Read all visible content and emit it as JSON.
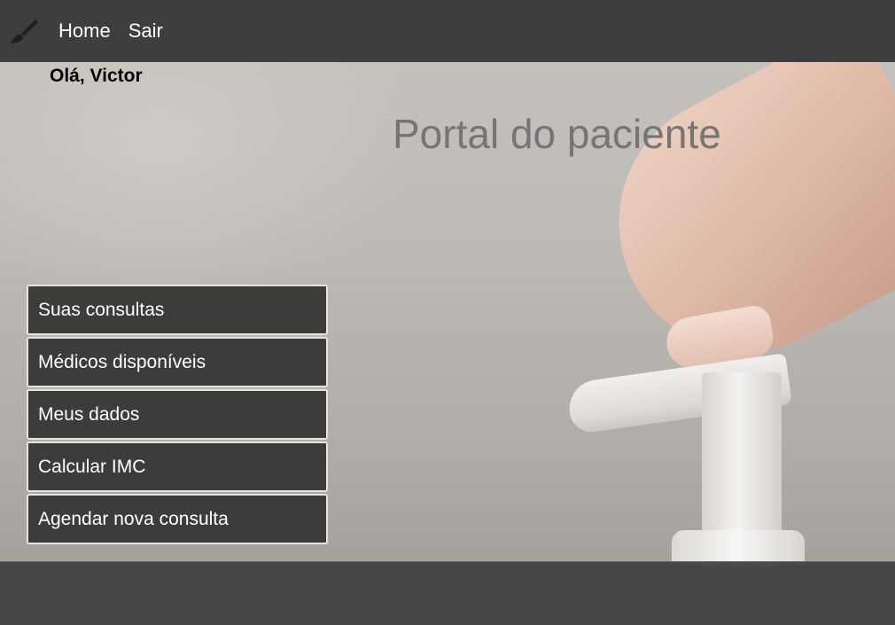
{
  "nav": {
    "brand_icon": "paintbrush-icon",
    "links": [
      "Home",
      "Sair"
    ]
  },
  "greeting": "Olá, Victor",
  "title": "Portal do paciente",
  "menu": {
    "items": [
      "Suas consultas",
      "Médicos disponíveis",
      "Meus dados",
      "Calcular IMC",
      "Agendar nova consulta"
    ]
  },
  "colors": {
    "navbar": "#3d3e40",
    "menu_button": "#3d3c3b",
    "menu_border": "#e6e4e1",
    "title_text": "#767573"
  }
}
